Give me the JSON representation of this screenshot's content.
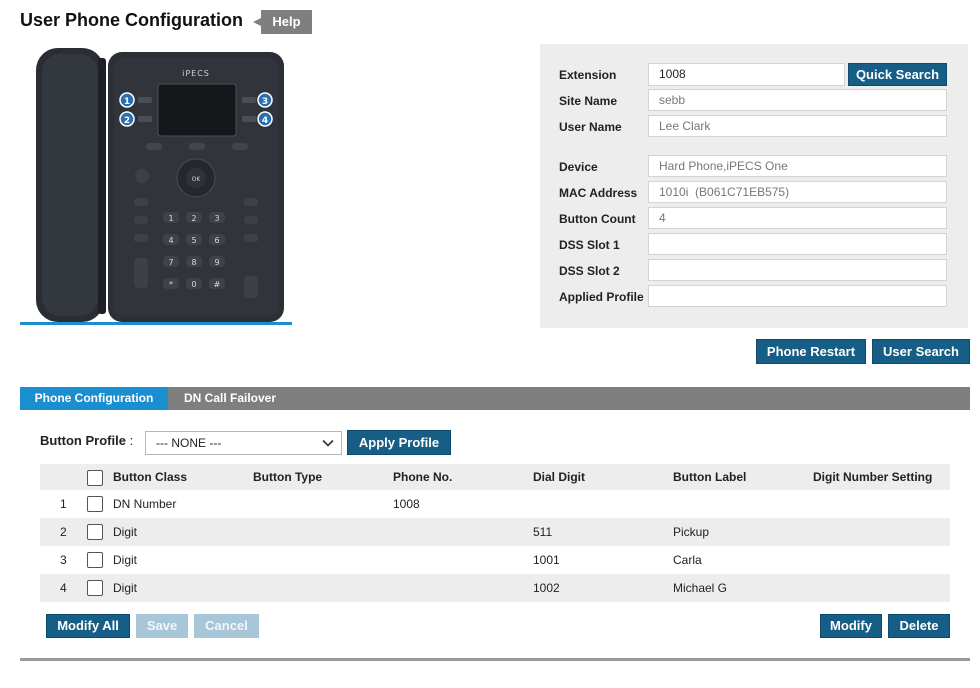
{
  "page": {
    "title": "User Phone Configuration",
    "help_label": "Help"
  },
  "phone_image": {
    "brand": "iPECS",
    "button_markers": [
      "1",
      "2",
      "3",
      "4"
    ],
    "ok_label": "OK",
    "keypad": [
      "1",
      "2",
      "3",
      "4",
      "5",
      "6",
      "7",
      "8",
      "9",
      "*",
      "0",
      "#"
    ]
  },
  "info": {
    "extension_label": "Extension",
    "extension_value": "1008",
    "quick_search_label": "Quick Search",
    "site_name_label": "Site Name",
    "site_name_value": "sebb",
    "user_name_label": "User Name",
    "user_name_value": "Lee Clark",
    "device_label": "Device",
    "device_value": "Hard Phone,iPECS One",
    "mac_label": "MAC Address",
    "mac_value": "1010i  (B061C71EB575)",
    "button_count_label": "Button Count",
    "button_count_value": "4",
    "dss1_label": "DSS Slot 1",
    "dss1_value": "",
    "dss2_label": "DSS Slot 2",
    "dss2_value": "",
    "applied_profile_label": "Applied Profile",
    "applied_profile_value": ""
  },
  "actions": {
    "phone_restart": "Phone Restart",
    "user_search": "User Search"
  },
  "tabs": [
    {
      "label": "Phone Configuration",
      "active": true
    },
    {
      "label": "DN Call Failover",
      "active": false
    }
  ],
  "profile": {
    "label": "Button Profile",
    "colon": ":",
    "selected": "--- NONE ---",
    "apply_label": "Apply Profile"
  },
  "table": {
    "headers": [
      "Button Class",
      "Button Type",
      "Phone No.",
      "Dial Digit",
      "Button Label",
      "Digit Number Setting"
    ],
    "rows": [
      {
        "num": "1",
        "class": "DN Number",
        "type": "",
        "phone": "1008",
        "dial": "",
        "label": "",
        "setting": ""
      },
      {
        "num": "2",
        "class": "Digit",
        "type": "",
        "phone": "",
        "dial": "511",
        "label": "Pickup",
        "setting": ""
      },
      {
        "num": "3",
        "class": "Digit",
        "type": "",
        "phone": "",
        "dial": "1001",
        "label": "Carla",
        "setting": ""
      },
      {
        "num": "4",
        "class": "Digit",
        "type": "",
        "phone": "",
        "dial": "1002",
        "label": "Michael G",
        "setting": ""
      }
    ]
  },
  "footer": {
    "modify_all": "Modify All",
    "save": "Save",
    "cancel": "Cancel",
    "modify": "Modify",
    "delete": "Delete"
  },
  "colors": {
    "primary_button": "#165e86",
    "tab_active": "#1b8ed0",
    "tab_bar": "#7f7f7f",
    "panel_bg": "#ededed",
    "disabled_button": "#a7c6d8"
  }
}
